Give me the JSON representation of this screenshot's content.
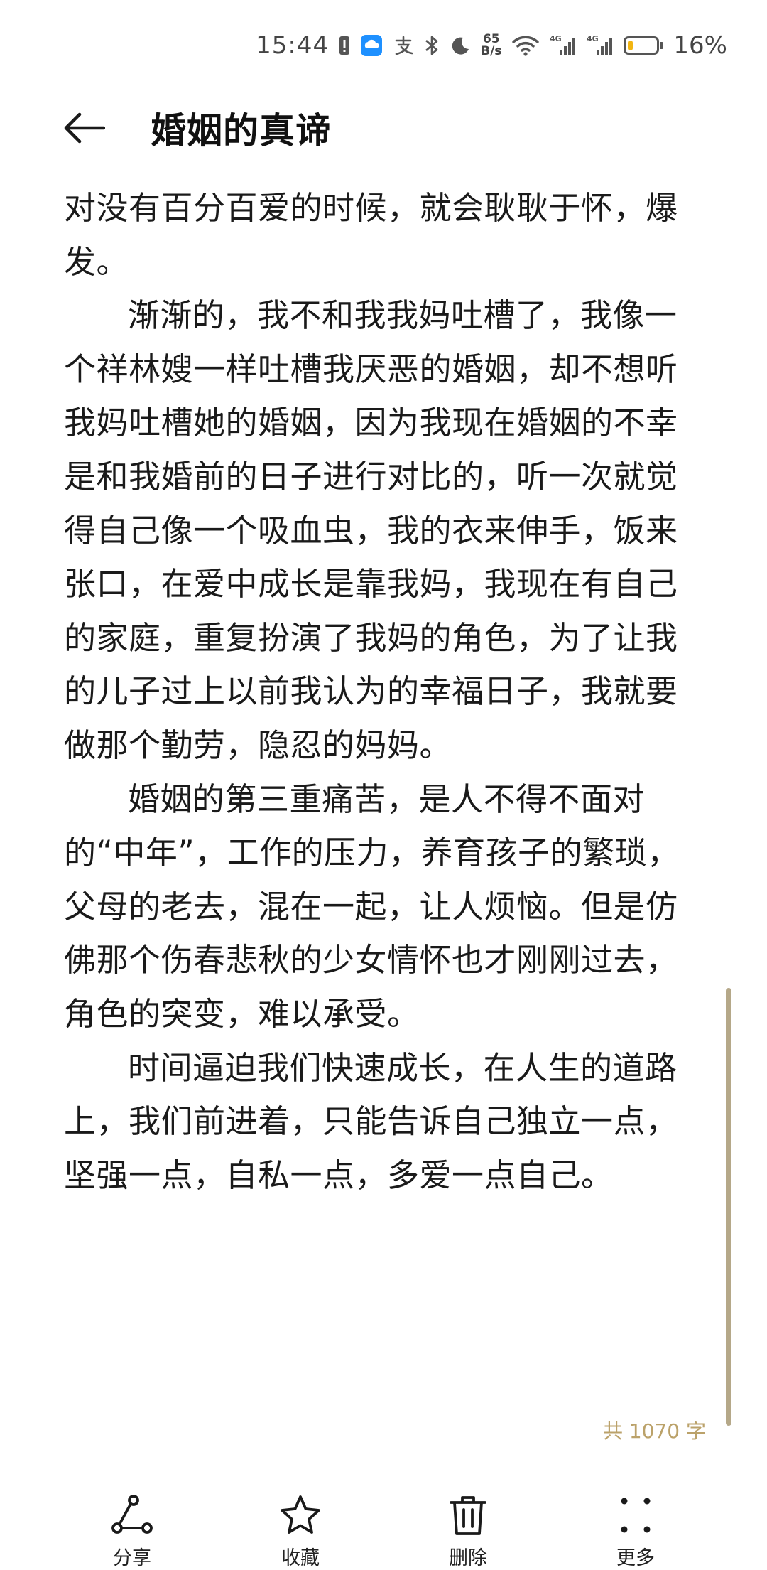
{
  "status_bar": {
    "time": "15:44",
    "net_speed_value": "65",
    "net_speed_unit": "B/s",
    "battery_percent": "16%",
    "battery_level": 0.16,
    "icons": [
      "sim-alert-icon",
      "app-notification-icon",
      "alipay-icon",
      "bluetooth-icon",
      "moon-icon",
      "wifi-icon",
      "signal-4g-icon",
      "signal-4g-icon",
      "battery-icon"
    ]
  },
  "header": {
    "title": "婚姻的真谛"
  },
  "article": {
    "paragraphs": [
      "对没有百分百爱的时候，就会耿耿于怀，爆发。",
      "渐渐的，我不和我我妈吐槽了，我像一个祥林嫂一样吐槽我厌恶的婚姻，却不想听我妈吐槽她的婚姻，因为我现在婚姻的不幸是和我婚前的日子进行对比的，听一次就觉得自己像一个吸血虫，我的衣来伸手，饭来张口，在爱中成长是靠我妈，我现在有自己的家庭，重复扮演了我妈的角色，为了让我的儿子过上以前我认为的幸福日子，我就要做那个勤劳，隐忍的妈妈。",
      "婚姻的第三重痛苦，是人不得不面对的“中年”，工作的压力，养育孩子的繁琐，父母的老去，混在一起，让人烦恼。但是仿佛那个伤春悲秋的少女情怀也才刚刚过去，角色的突变，难以承受。",
      "时间逼迫我们快速成长，在人生的道路上，我们前进着，只能告诉自己独立一点，坚强一点，自私一点，多爱一点自己。"
    ],
    "word_count": "共 1070 字"
  },
  "toolbar": {
    "share_label": "分享",
    "favorite_label": "收藏",
    "delete_label": "删除",
    "more_label": "更多"
  },
  "colors": {
    "accent": "#bba26a",
    "scrollbar": "#b5a889",
    "battery_low": "#f2b511"
  }
}
